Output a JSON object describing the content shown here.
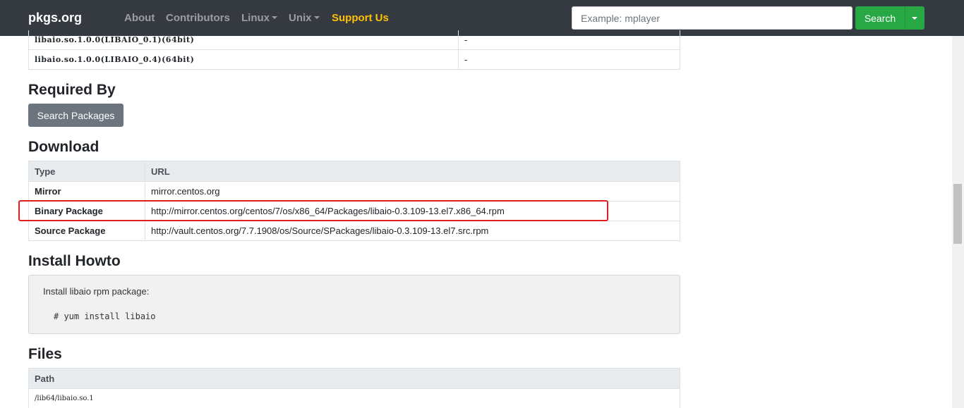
{
  "nav": {
    "brand": "pkgs.org",
    "links": [
      {
        "label": "About"
      },
      {
        "label": "Contributors"
      },
      {
        "label": "Linux"
      },
      {
        "label": "Unix"
      },
      {
        "label": "Support Us"
      }
    ],
    "search_placeholder": "Example: mplayer",
    "search_button": "Search"
  },
  "provides": {
    "rows": [
      {
        "name": "libaio.so.1.0.0(LIBAIO_0.1)(64bit)",
        "value": "-"
      },
      {
        "name": "libaio.so.1.0.0(LIBAIO_0.4)(64bit)",
        "value": "-"
      }
    ]
  },
  "required_by": {
    "heading": "Required By",
    "button": "Search Packages"
  },
  "download": {
    "heading": "Download",
    "columns": [
      "Type",
      "URL"
    ],
    "rows": [
      {
        "type": "Mirror",
        "url": "mirror.centos.org"
      },
      {
        "type": "Binary Package",
        "url": "http://mirror.centos.org/centos/7/os/x86_64/Packages/libaio-0.3.109-13.el7.x86_64.rpm"
      },
      {
        "type": "Source Package",
        "url": "http://vault.centos.org/7.7.1908/os/Source/SPackages/libaio-0.3.109-13.el7.src.rpm"
      }
    ]
  },
  "install": {
    "heading": "Install Howto",
    "text": "Install libaio rpm package:",
    "command": "# yum install libaio"
  },
  "files": {
    "heading": "Files",
    "column": "Path",
    "rows": [
      "/lib64/libaio.so.1"
    ]
  },
  "colors": {
    "navbar": "#343a40",
    "support": "#ffc107",
    "search_button": "#28a745",
    "secondary_button": "#6c757d",
    "highlight_box": "#e02020"
  }
}
